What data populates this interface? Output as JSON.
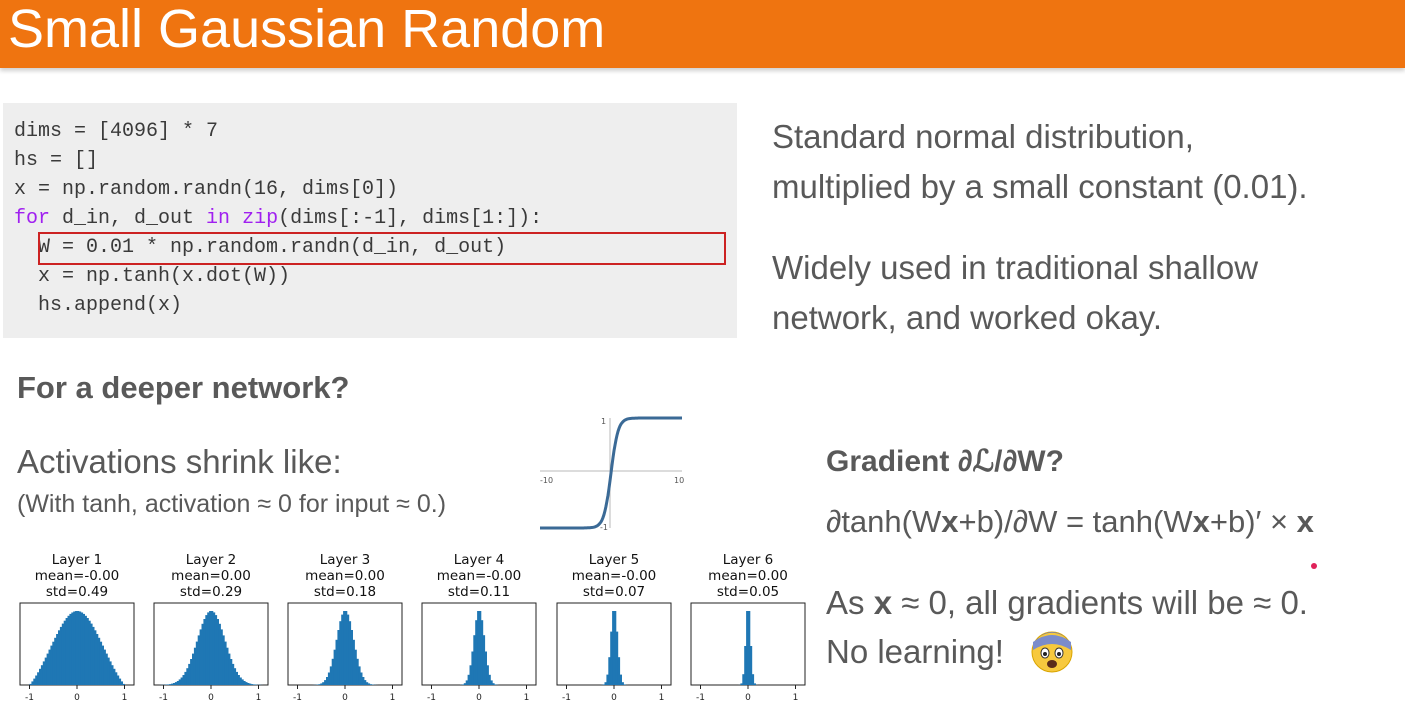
{
  "slide": {
    "title": "Small Gaussian Random",
    "code_lines": [
      "dims = [4096] * 7",
      "hs = []",
      "x = np.random.randn(16, dims[0])",
      "for d_in, d_out in zip(dims[:-1], dims[1:]):",
      "  W = 0.01 * np.random.randn(d_in, d_out)",
      "  x = np.tanh(x.dot(W))",
      "  hs.append(x)"
    ],
    "desc1_line1": "Standard normal distribution,",
    "desc1_line2": "multiplied by a small constant (0.01).",
    "desc2_line1": "Widely used in traditional shallow",
    "desc2_line2": "network, and worked okay.",
    "deeper_heading": "For a deeper network?",
    "shrink_text": "Activations shrink like:",
    "shrink_note": "(With tanh, activation ≈ 0 for input ≈ 0.)",
    "gradient_heading": "Gradient ∂ℒ/∂W?",
    "gradient_formula_a": "∂tanh(W",
    "gradient_formula_b": "x",
    "gradient_formula_c": "+b)/∂W = tanh(W",
    "gradient_formula_d": "x",
    "gradient_formula_e": "+b)′ × ",
    "gradient_formula_f": "x",
    "conclusion_a": "As ",
    "conclusion_b": "x",
    "conclusion_c": " ≈ 0, all gradients will be ≈ 0.",
    "conclusion_line2": "No learning!",
    "emoji_name": "fearful-face-icon"
  },
  "tanh_plot": {
    "type": "line",
    "function": "tanh",
    "xlim": [
      -10,
      10
    ],
    "ylim": [
      -1,
      1
    ],
    "x_tick_labels": [
      "-10",
      "10"
    ],
    "y_tick_labels": [
      "1",
      "-1"
    ],
    "line_color": "#3b6a96"
  },
  "chart_data": {
    "type": "bar",
    "series_color": "#1f77b4",
    "xlim": [
      -1,
      1
    ],
    "x_tick_labels": [
      "-1",
      "0",
      "1"
    ],
    "panels": [
      {
        "title": "Layer 1",
        "mean": "mean=-0.00",
        "std_label": "std=0.49",
        "std": 0.49
      },
      {
        "title": "Layer 2",
        "mean": "mean=0.00",
        "std_label": "std=0.29",
        "std": 0.29
      },
      {
        "title": "Layer 3",
        "mean": "mean=0.00",
        "std_label": "std=0.18",
        "std": 0.18
      },
      {
        "title": "Layer 4",
        "mean": "mean=-0.00",
        "std_label": "std=0.11",
        "std": 0.11
      },
      {
        "title": "Layer 5",
        "mean": "mean=-0.00",
        "std_label": "std=0.07",
        "std": 0.07
      },
      {
        "title": "Layer 6",
        "mean": "mean=0.00",
        "std_label": "std=0.05",
        "std": 0.05
      }
    ]
  }
}
